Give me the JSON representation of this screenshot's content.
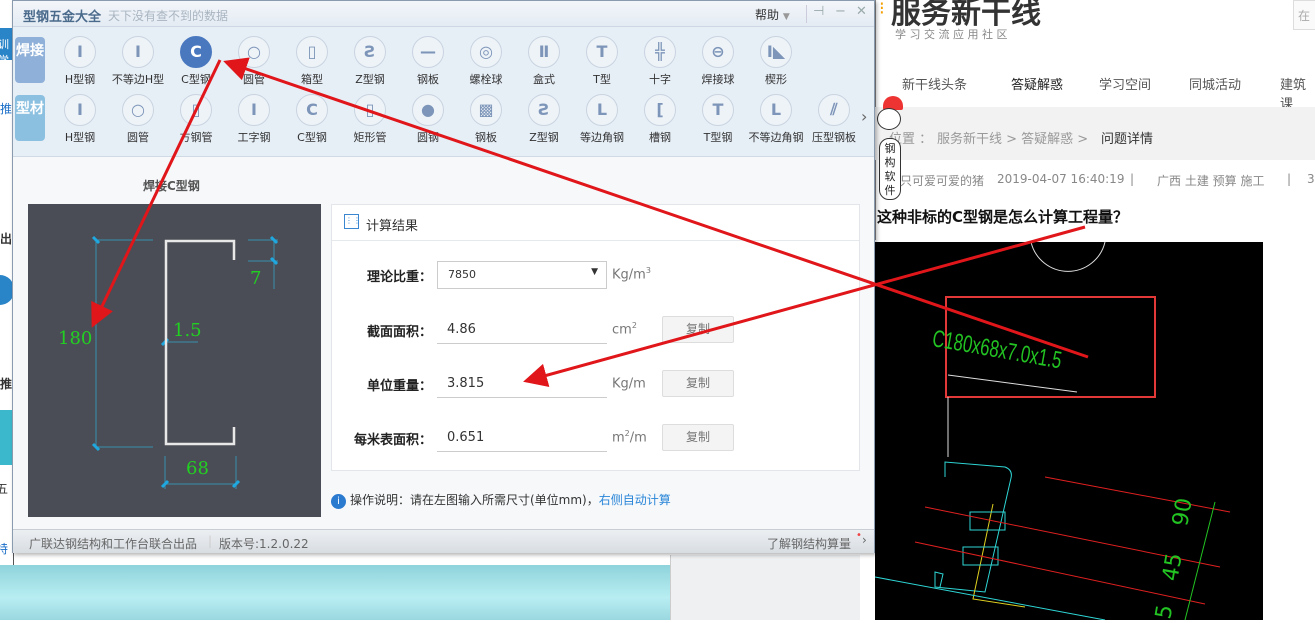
{
  "dialog": {
    "title": "型钢五金大全",
    "slogan": "天下没有查不到的数据",
    "help_label": "帮助",
    "categories": [
      {
        "label": "焊接",
        "active": true
      },
      {
        "label": "型材",
        "active": false
      }
    ],
    "weld_items": [
      {
        "label": "H型钢",
        "glyph": "I"
      },
      {
        "label": "不等边H型",
        "glyph": "I"
      },
      {
        "label": "C型钢",
        "glyph": "C",
        "selected": true
      },
      {
        "label": "圆管",
        "glyph": "○"
      },
      {
        "label": "箱型",
        "glyph": "▯"
      },
      {
        "label": "Z型钢",
        "glyph": "Ƨ"
      },
      {
        "label": "钢板",
        "glyph": "—"
      },
      {
        "label": "螺栓球",
        "glyph": "◎"
      },
      {
        "label": "盒式",
        "glyph": "Ⅱ"
      },
      {
        "label": "T型",
        "glyph": "T"
      },
      {
        "label": "十字",
        "glyph": "╬"
      },
      {
        "label": "焊接球",
        "glyph": "⊖"
      },
      {
        "label": "楔形",
        "glyph": "I◣"
      }
    ],
    "profile_items": [
      {
        "label": "H型钢",
        "glyph": "I"
      },
      {
        "label": "圆管",
        "glyph": "○"
      },
      {
        "label": "方钢管",
        "glyph": "▯"
      },
      {
        "label": "工字钢",
        "glyph": "I"
      },
      {
        "label": "C型钢",
        "glyph": "C"
      },
      {
        "label": "矩形管",
        "glyph": "▯"
      },
      {
        "label": "圆钢",
        "glyph": "●"
      },
      {
        "label": "钢板",
        "glyph": "▩"
      },
      {
        "label": "Z型钢",
        "glyph": "Ƨ"
      },
      {
        "label": "等边角钢",
        "glyph": "L"
      },
      {
        "label": "槽钢",
        "glyph": "["
      },
      {
        "label": "T型钢",
        "glyph": "T"
      },
      {
        "label": "不等边角钢",
        "glyph": "L"
      },
      {
        "label": "压型钢板",
        "glyph": "⫽"
      }
    ],
    "shape_title": "焊接C型钢",
    "dimensions": {
      "height": "180",
      "width": "68",
      "lip": "7",
      "thickness": "1.5"
    },
    "result": {
      "header": "计算结果",
      "rows": [
        {
          "label": "理论比重：",
          "value": "7850",
          "unit": "Kg/m",
          "sup": "3",
          "type": "select"
        },
        {
          "label": "截面面积：",
          "value": "4.86",
          "unit": "cm",
          "sup": "2",
          "copy": "复制"
        },
        {
          "label": "单位重量：",
          "value": "3.815",
          "unit": "Kg/m",
          "sup": "",
          "copy": "复制"
        },
        {
          "label": "每米表面积：",
          "value": "0.651",
          "unit": "m",
          "sup": "2",
          "unit_tail": "/m",
          "copy": "复制"
        }
      ]
    },
    "note": {
      "text": "操作说明：请在左图输入所需尺寸(单位mm)，",
      "link": "右侧自动计算"
    },
    "footer": {
      "producer": "广联达钢结构和工作台联合出品",
      "version": "版本号:1.2.0.22",
      "learn_more": "了解钢结构算量"
    }
  },
  "web": {
    "logo": "服务新干线",
    "logo_sub": "学 习 交 流 应 用 社 区",
    "search_placeholder": "在",
    "nav": [
      "新干线头条",
      "答疑解惑",
      "学习空间",
      "同城活动",
      "建筑课"
    ],
    "breadcrumb": {
      "prefix": "位置 ：",
      "path": "服务新干线 > 答疑解惑 >",
      "current": "问题详情"
    },
    "meta": {
      "author": "只可爱可爱的猪",
      "time": "2019-04-07 16:40:19",
      "sep": "|",
      "tags": "广西  土建 预算 施工",
      "sep2": "|",
      "more": "3"
    },
    "mascot_text": "钢构软件",
    "question_title": "这种非标的C型钢是怎么计算工程量？",
    "cad_label": "C180x68x7.0x1.5",
    "cad_dims": [
      "90",
      "45",
      "5"
    ]
  },
  "left_window": {
    "fragments": [
      "训学",
      "推",
      "出",
      "推",
      "五",
      "特"
    ]
  },
  "colors": {
    "accent": "#4a78bf",
    "arrow": "#e0161a",
    "cad_green": "#22c322",
    "drawing_bg": "#4a4d55"
  }
}
